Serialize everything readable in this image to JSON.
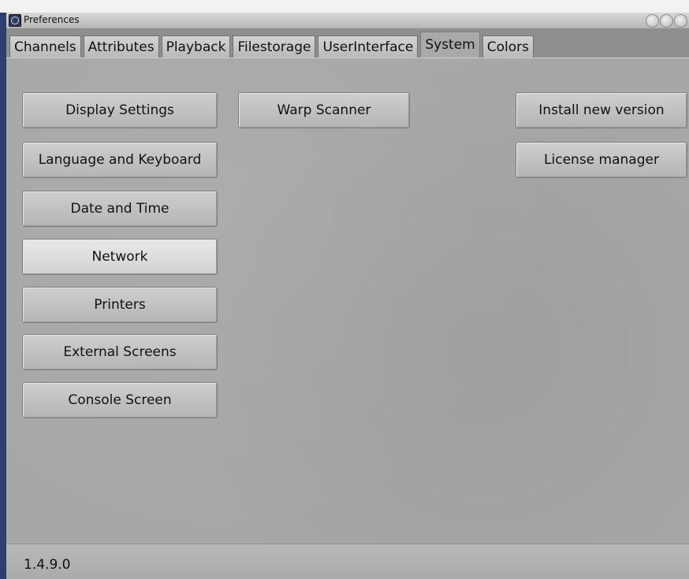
{
  "window": {
    "title": "Preferences"
  },
  "tabs": [
    {
      "label": "Channels",
      "active": false
    },
    {
      "label": "Attributes",
      "active": false
    },
    {
      "label": "Playback",
      "active": false
    },
    {
      "label": "Filestorage",
      "active": false
    },
    {
      "label": "UserInterface",
      "active": false
    },
    {
      "label": "System",
      "active": true
    },
    {
      "label": "Colors",
      "active": false
    }
  ],
  "buttons": {
    "display_settings": "Display Settings",
    "language_keyboard": "Language and Keyboard",
    "date_time": "Date and Time",
    "network": "Network",
    "printers": "Printers",
    "external_screens": "External Screens",
    "console_screen": "Console Screen",
    "warp_scanner": "Warp Scanner",
    "install_new_version": "Install new version",
    "license_manager": "License manager"
  },
  "status": {
    "version": "1.4.9.0"
  },
  "icons": {
    "app": "app-logo-icon",
    "window_controls": [
      "minimize-icon",
      "maximize-icon",
      "close-icon"
    ]
  }
}
